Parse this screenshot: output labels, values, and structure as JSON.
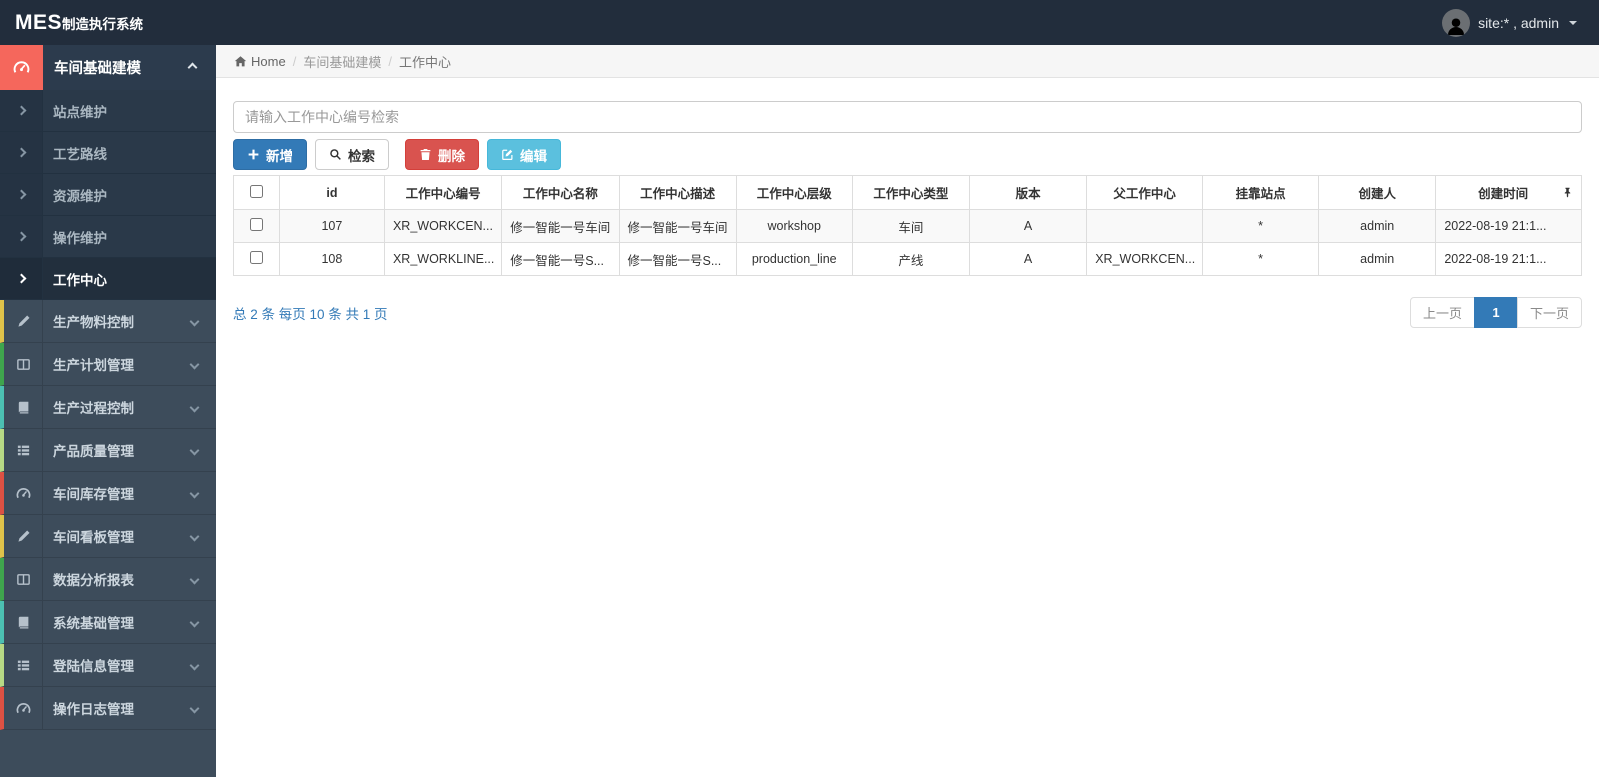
{
  "topbar": {
    "brand_primary": "MES",
    "brand_secondary": "制造执行系统",
    "user_label": "site:* , admin"
  },
  "sidebar": {
    "group": {
      "label": "车间基础建模",
      "icon": "gauge-icon",
      "expanded": true
    },
    "sub_items": [
      {
        "label": "站点维护",
        "active": false
      },
      {
        "label": "工艺路线",
        "active": false
      },
      {
        "label": "资源维护",
        "active": false
      },
      {
        "label": "操作维护",
        "active": false
      },
      {
        "label": "工作中心",
        "active": true
      }
    ],
    "items": [
      {
        "label": "生产物料控制",
        "icon": "pencil-icon",
        "strip_color": "#dfc24a"
      },
      {
        "label": "生产计划管理",
        "icon": "columns-icon",
        "strip_color": "#3fa54d"
      },
      {
        "label": "生产过程控制",
        "icon": "book-icon",
        "strip_color": "#4cc0b2"
      },
      {
        "label": "产品质量管理",
        "icon": "list-icon",
        "strip_color": "#b7d985"
      },
      {
        "label": "车间库存管理",
        "icon": "gauge-icon",
        "strip_color": "#dd5143"
      },
      {
        "label": "车间看板管理",
        "icon": "pencil-icon",
        "strip_color": "#dfc24a"
      },
      {
        "label": "数据分析报表",
        "icon": "columns-icon",
        "strip_color": "#3fa54d"
      },
      {
        "label": "系统基础管理",
        "icon": "book-icon",
        "strip_color": "#4cc0b2"
      },
      {
        "label": "登陆信息管理",
        "icon": "list-icon",
        "strip_color": "#b7d985"
      },
      {
        "label": "操作日志管理",
        "icon": "gauge-icon",
        "strip_color": "#dd5143"
      }
    ]
  },
  "breadcrumb": {
    "home": "Home",
    "section": "车间基础建模",
    "current": "工作中心"
  },
  "search": {
    "placeholder": "请输入工作中心编号检索",
    "value": ""
  },
  "toolbar": {
    "add_label": "新增",
    "search_label": "检索",
    "delete_label": "删除",
    "edit_label": "编辑"
  },
  "table": {
    "headers": [
      "id",
      "工作中心编号",
      "工作中心名称",
      "工作中心描述",
      "工作中心层级",
      "工作中心类型",
      "版本",
      "父工作中心",
      "挂靠站点",
      "创建人",
      "创建时间"
    ],
    "rows": [
      [
        "107",
        "XR_WORKCEN...",
        "修一智能一号车间",
        "修一智能一号车间",
        "workshop",
        "车间",
        "A",
        "",
        "*",
        "admin",
        "2022-08-19 21:1..."
      ],
      [
        "108",
        "XR_WORKLINE...",
        "修一智能一号S...",
        "修一智能一号S...",
        "production_line",
        "产线",
        "A",
        "XR_WORKCEN...",
        "*",
        "admin",
        "2022-08-19 21:1..."
      ]
    ]
  },
  "pagination": {
    "summary": "总 2 条  每页 10 条  共 1 页",
    "prev_label": "上一页",
    "page": "1",
    "next_label": "下一页"
  },
  "colors": {
    "topbar_bg": "#222d3c",
    "sidebar_bg": "#3d4c5b",
    "submenu_bg": "#2a3949",
    "accent_coral": "#f5675c",
    "primary_blue": "#337ab7",
    "danger_red": "#d9534f",
    "info_blue": "#5bc0de",
    "link_blue": "#337ab7"
  }
}
